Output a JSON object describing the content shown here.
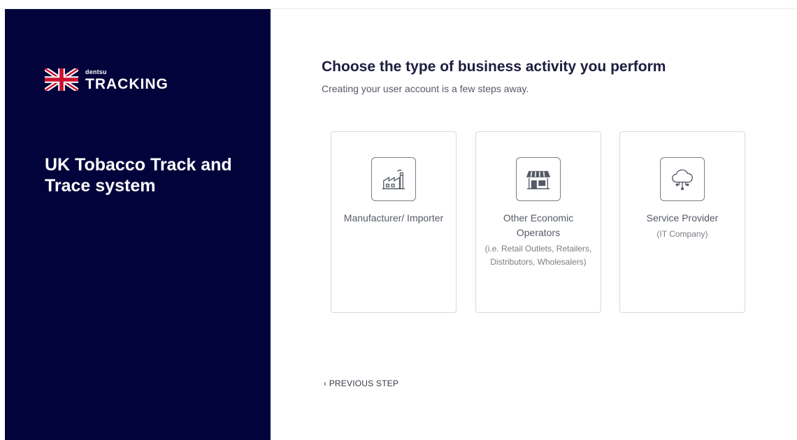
{
  "sidebar": {
    "logo": {
      "brand": "dentsu",
      "product": "TRACKING",
      "flag_icon": "uk-flag-icon"
    },
    "title": "UK Tobacco Track and Trace system"
  },
  "main": {
    "title": "Choose the type of business activity you perform",
    "subtitle": "Creating your user account is a few steps away.",
    "options": [
      {
        "icon": "factory-icon",
        "label": "Manufacturer/ Importer",
        "note": ""
      },
      {
        "icon": "store-icon",
        "label": "Other Economic Operators",
        "note": "(i.e. Retail Outlets, Retailers, Distributors, Wholesalers)"
      },
      {
        "icon": "cloud-network-icon",
        "label": "Service Provider",
        "note": "(IT Company)"
      }
    ],
    "previous_step": "‹ PREVIOUS STEP"
  },
  "colors": {
    "sidebar_bg": "#02033b",
    "title_text": "#1d1c3f",
    "body_text": "#555a66",
    "card_border": "#d9d9d9"
  }
}
